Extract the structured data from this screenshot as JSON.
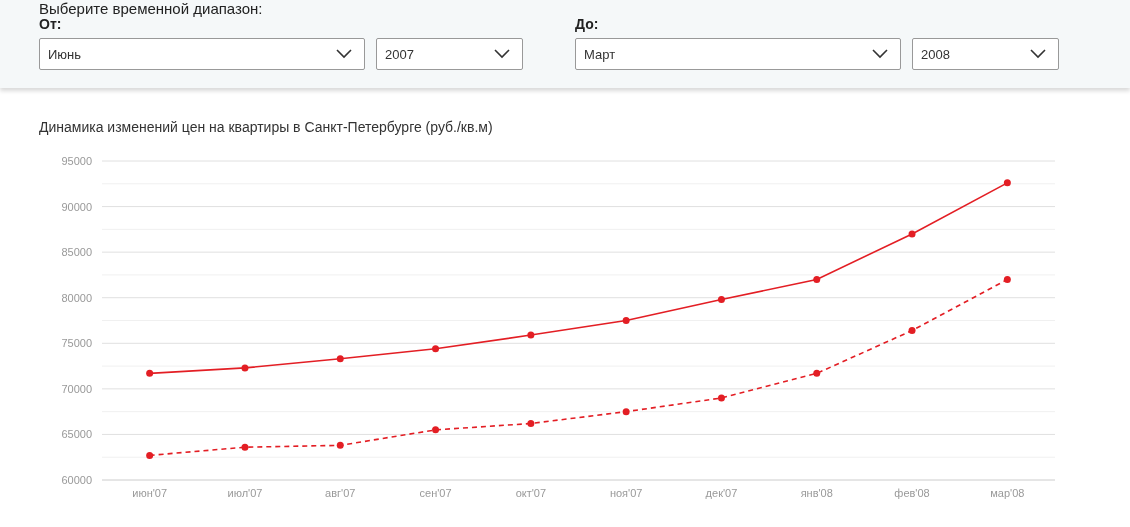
{
  "intro": "Выберите временной диапазон:",
  "ranges": [
    {
      "label": "От:",
      "month": "Июнь",
      "year": "2007"
    },
    {
      "label": "До:",
      "month": "Март",
      "year": "2008"
    }
  ],
  "chart": {
    "title": "Динамика изменений цен на квартиры в Санкт-Петербурге (руб./кв.м)",
    "chart_data": {
      "type": "line",
      "categories": [
        "июн'07",
        "июл'07",
        "авг'07",
        "сен'07",
        "окт'07",
        "ноя'07",
        "дек'07",
        "янв'08",
        "фев'08",
        "мар'08"
      ],
      "series": [
        {
          "color": "#e31e24",
          "line_style": "solid",
          "marker": "circle",
          "values": [
            71700,
            72300,
            73300,
            74400,
            75900,
            77500,
            79800,
            82000,
            87000,
            92600
          ]
        },
        {
          "color": "#e31e24",
          "line_style": "dashed",
          "marker": "circle",
          "values": [
            62700,
            63600,
            63800,
            65500,
            66200,
            67500,
            69000,
            71700,
            76400,
            82000
          ]
        }
      ],
      "grid": true,
      "ylim": [
        60000,
        95000
      ],
      "yticks": [
        60000,
        65000,
        70000,
        75000,
        80000,
        85000,
        90000,
        95000
      ]
    }
  }
}
